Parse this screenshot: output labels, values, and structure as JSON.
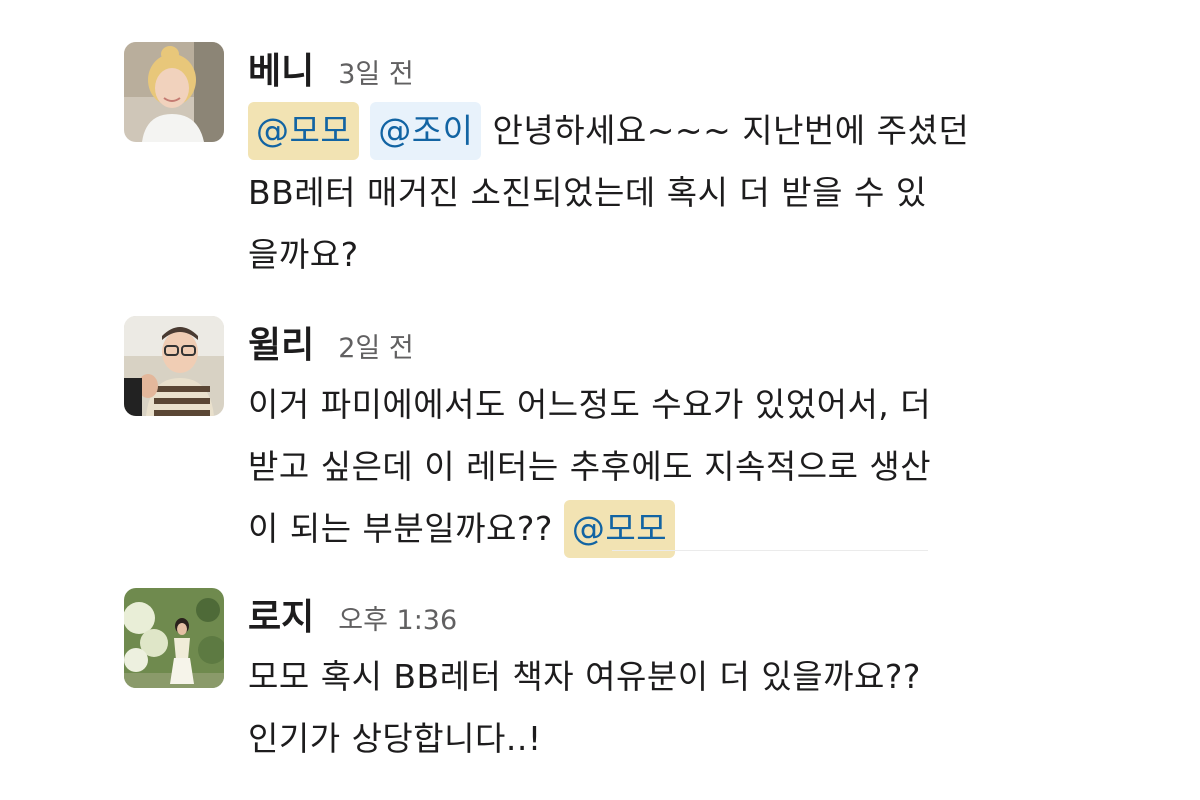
{
  "messages": [
    {
      "author": "베니",
      "timestamp": "3일 전",
      "avatar": "woman-blonde-hair-avatar",
      "mentions": [
        "@모모",
        "@조이"
      ],
      "lines": [
        "안녕하세요~~~ 지난번에 주셨던",
        "BB레터 매거진 소진되었는데 혹시 더 받을 수 있",
        "을까요?"
      ]
    },
    {
      "author": "윌리",
      "timestamp": "2일 전",
      "avatar": "man-glasses-thumbs-up-avatar",
      "lines": [
        "이거 파미에에서도 어느정도 수요가 있었어서, 더",
        "받고 싶은데 이 레터는 추후에도 지속적으로 생산",
        "이 되는 부분일까요??"
      ],
      "mentions": [
        "@모모"
      ]
    },
    {
      "author": "로지",
      "timestamp": "오후 1:36",
      "avatar": "woman-flowers-avatar",
      "lines": [
        "모모 혹시 BB레터 책자 여유분이 더 있을까요??",
        "인기가 상당합니다..!"
      ]
    }
  ],
  "colors": {
    "mention_text": "#1264a3",
    "mention_self_bg": "#f2e3b3",
    "mention_other_bg": "#e8f2fb",
    "timestamp": "#616061"
  }
}
